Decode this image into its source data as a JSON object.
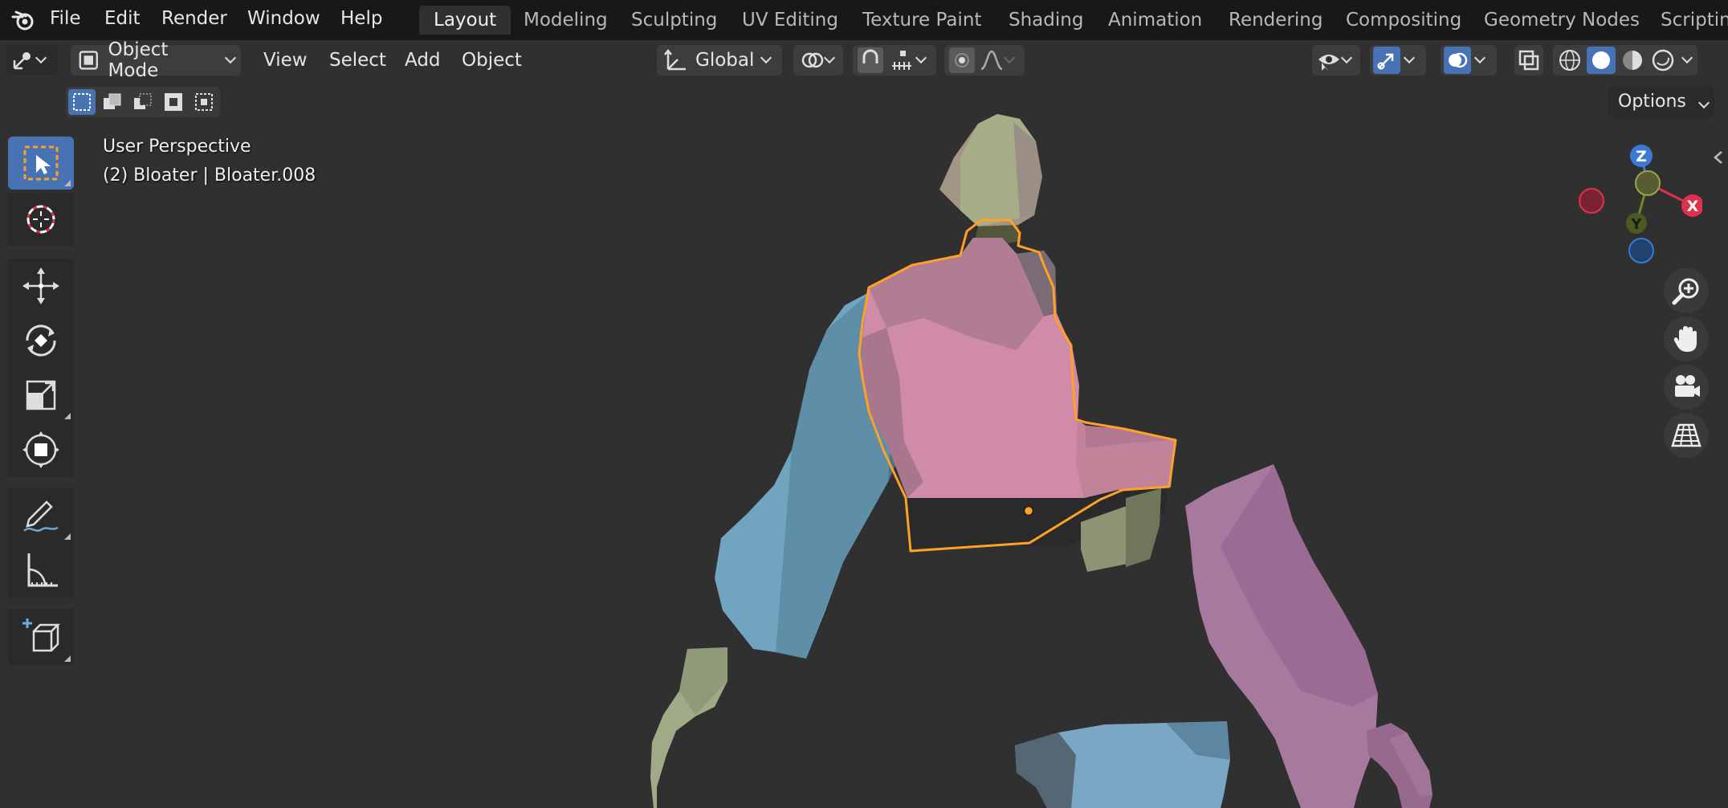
{
  "menubar": {
    "items": [
      "File",
      "Edit",
      "Render",
      "Window",
      "Help"
    ]
  },
  "workspaces": {
    "tabs": [
      "Layout",
      "Modeling",
      "Sculpting",
      "UV Editing",
      "Texture Paint",
      "Shading",
      "Animation",
      "Rendering",
      "Compositing",
      "Geometry Nodes",
      "Scripting"
    ],
    "active": "Layout"
  },
  "header": {
    "mode": "Object Mode",
    "menus": [
      "View",
      "Select",
      "Add",
      "Object"
    ],
    "transform_orientation": "Global",
    "options_label": "Options"
  },
  "viewport": {
    "perspective_label": "User Perspective",
    "object_label": "(2) Bloater | Bloater.008"
  },
  "gizmo": {
    "z": "Z",
    "x": "X",
    "y": "Y"
  },
  "colors": {
    "accent": "#4772b3",
    "selection_outline": "#ffa028",
    "topbar": "#181818",
    "viewport_bg": "#303030",
    "axis_x": "#e0314b",
    "axis_y": "#6b8a1f",
    "axis_z": "#3a7ad4"
  }
}
